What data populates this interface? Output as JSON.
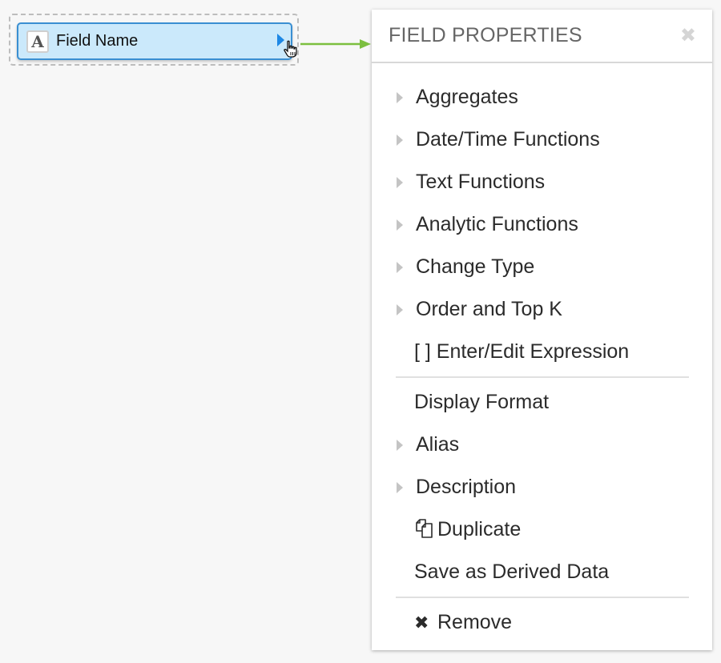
{
  "field": {
    "type_icon": "A",
    "type_icon_name": "text-type-icon",
    "name": "Field Name",
    "accent_color": "#1e88e5",
    "pill_color": "#cbe9fb"
  },
  "connector": {
    "color": "#7cbf3f"
  },
  "panel": {
    "title": "FIELD PROPERTIES",
    "close_icon": "✖",
    "groups": [
      {
        "items": [
          {
            "label": "Aggregates",
            "icon": "caret-right-icon",
            "expandable": true
          },
          {
            "label": "Date/Time Functions",
            "icon": "caret-right-icon",
            "expandable": true
          },
          {
            "label": "Text Functions",
            "icon": "caret-right-icon",
            "expandable": true
          },
          {
            "label": "Analytic Functions",
            "icon": "caret-right-icon",
            "expandable": true
          },
          {
            "label": "Change Type",
            "icon": "caret-right-icon",
            "expandable": true
          },
          {
            "label": "Order and Top K",
            "icon": "caret-right-icon",
            "expandable": true
          },
          {
            "label": "[ ] Enter/Edit Expression",
            "icon": null,
            "expandable": false
          }
        ]
      },
      {
        "items": [
          {
            "label": "Display Format",
            "icon": null,
            "expandable": false
          },
          {
            "label": "Alias",
            "icon": "caret-right-icon",
            "expandable": true
          },
          {
            "label": "Description",
            "icon": "caret-right-icon",
            "expandable": true
          },
          {
            "label": "Duplicate",
            "icon": "duplicate-icon",
            "expandable": false
          },
          {
            "label": "Save as Derived Data",
            "icon": null,
            "expandable": false
          }
        ]
      },
      {
        "items": [
          {
            "label": "Remove",
            "icon": "remove-icon",
            "glyph": "✖",
            "expandable": false
          }
        ]
      }
    ]
  }
}
